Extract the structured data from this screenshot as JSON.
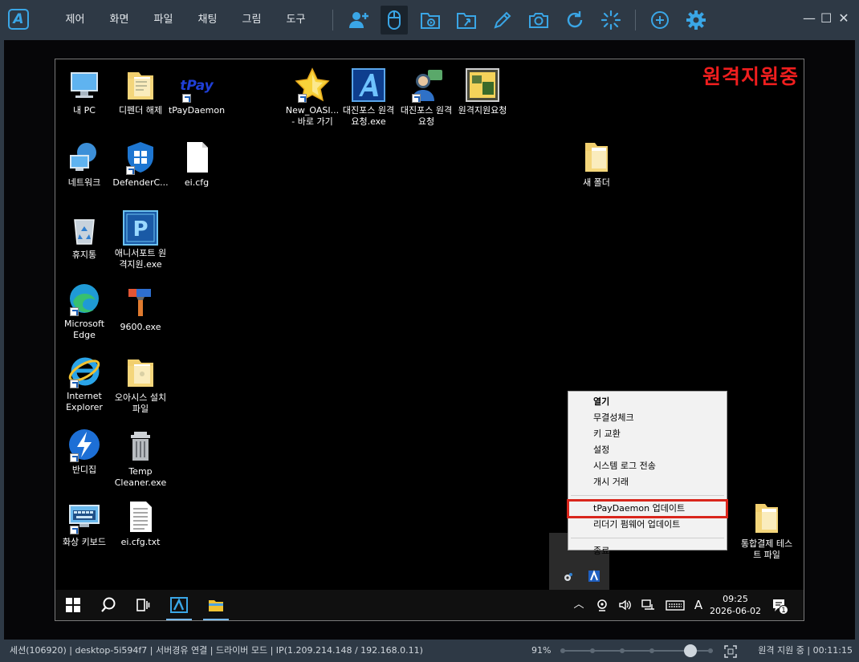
{
  "menu": [
    "제어",
    "화면",
    "파일",
    "채팅",
    "그림",
    "도구"
  ],
  "tool_icons": [
    "add-user-icon",
    "mouse-icon",
    "screen-folder-icon",
    "file-transfer-icon",
    "pen-icon",
    "camera-icon",
    "refresh-icon",
    "loading-icon",
    "add-circle-icon",
    "gear-icon"
  ],
  "window_controls": {
    "minimize": "—",
    "maximize": "☐",
    "close": "✕"
  },
  "banner": "원격지원중",
  "desktop_icons": [
    {
      "name": "mypc",
      "label": "내 PC"
    },
    {
      "name": "defender-folder",
      "label": "디펜더 해제"
    },
    {
      "name": "tpaydaemon",
      "label": "tPayDaemon",
      "logo": "tPay"
    },
    {
      "name": "new-oasis",
      "label": "New_OASI... - 바로 가기"
    },
    {
      "name": "daejin-exe",
      "label": "대진포스 원격요청.exe"
    },
    {
      "name": "daejin-req",
      "label": "대진포스 원격요청"
    },
    {
      "name": "remote-request",
      "label": "원격지원요청"
    },
    {
      "name": "network",
      "label": "네트워크"
    },
    {
      "name": "defenderc",
      "label": "DefenderC..."
    },
    {
      "name": "ei-cfg",
      "label": "ei.cfg"
    },
    {
      "name": "new-folder",
      "label": "새 폴더"
    },
    {
      "name": "recycle",
      "label": "휴지통"
    },
    {
      "name": "anysupport",
      "label": "애니서포트 원격지원.exe",
      "logo": "P"
    },
    {
      "name": "edge",
      "label": "Microsoft Edge"
    },
    {
      "name": "9600",
      "label": "9600.exe"
    },
    {
      "name": "ie",
      "label": "Internet Explorer"
    },
    {
      "name": "oasis-folder",
      "label": "오아시스 설치파일"
    },
    {
      "name": "bandizip",
      "label": "반디집"
    },
    {
      "name": "tempcleaner",
      "label": "Temp Cleaner.exe"
    },
    {
      "name": "keyboard",
      "label": "화상 키보드"
    },
    {
      "name": "ei-cfg-txt",
      "label": "ei.cfg.txt"
    },
    {
      "name": "payment-folder",
      "label": "통합결제 테스트 파일"
    }
  ],
  "context_menu": {
    "open": "열기",
    "integrity": "무결성체크",
    "key_exchange": "키 교환",
    "settings": "설정",
    "log_send": "시스템 로그 전송",
    "opening_deal": "개시 거래",
    "tpay_update": "tPayDaemon 업데이트",
    "reader_fw_update": "리더기 펌웨어 업데이트",
    "exit": "종료"
  },
  "taskbar": {
    "ime": "A",
    "time": "09:25",
    "date": "2026-06-02",
    "notification_count": "1"
  },
  "status": {
    "session": "세션(106920) | desktop-5i594f7 | 서버경유 연결 | 드라이버 모드 | IP(1.209.214.148 / 192.168.0.11)",
    "zoom": "91%",
    "zoom_level": 0.85,
    "right": "원격 지원 중 | 00:11:15"
  },
  "colors": {
    "toolbar_bg": "#2e3945",
    "icon_accent": "#3aa6e6",
    "banner": "#f01e1e",
    "highlight_border": "#d9261c"
  }
}
